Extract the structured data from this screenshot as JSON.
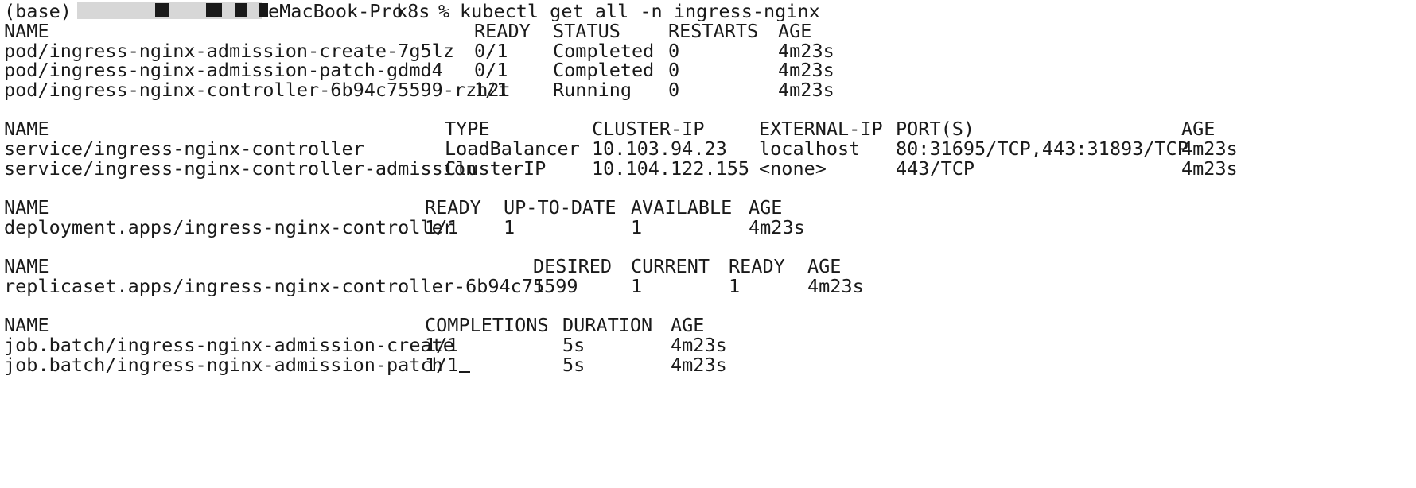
{
  "prompt": {
    "env": "(base)",
    "host_suffix": "eMacBook-Pro",
    "cwd": "k8s",
    "symbol": "%",
    "command": "kubectl get all -n ingress-nginx"
  },
  "pods": {
    "headers": [
      "NAME",
      "READY",
      "STATUS",
      "RESTARTS",
      "AGE"
    ],
    "rows": [
      [
        "pod/ingress-nginx-admission-create-7g5lz",
        "0/1",
        "Completed",
        "0",
        "4m23s"
      ],
      [
        "pod/ingress-nginx-admission-patch-gdmd4",
        "0/1",
        "Completed",
        "0",
        "4m23s"
      ],
      [
        "pod/ingress-nginx-controller-6b94c75599-rzh2t",
        "1/1",
        "Running",
        "0",
        "4m23s"
      ]
    ]
  },
  "services": {
    "headers": [
      "NAME",
      "TYPE",
      "CLUSTER-IP",
      "EXTERNAL-IP",
      "PORT(S)",
      "AGE"
    ],
    "rows": [
      [
        "service/ingress-nginx-controller",
        "LoadBalancer",
        "10.103.94.23",
        "localhost",
        "80:31695/TCP,443:31893/TCP",
        "4m23s"
      ],
      [
        "service/ingress-nginx-controller-admission",
        "ClusterIP",
        "10.104.122.155",
        "<none>",
        "443/TCP",
        "4m23s"
      ]
    ]
  },
  "deployments": {
    "headers": [
      "NAME",
      "READY",
      "UP-TO-DATE",
      "AVAILABLE",
      "AGE"
    ],
    "rows": [
      [
        "deployment.apps/ingress-nginx-controller",
        "1/1",
        "1",
        "1",
        "4m23s"
      ]
    ]
  },
  "replicasets": {
    "headers": [
      "NAME",
      "DESIRED",
      "CURRENT",
      "READY",
      "AGE"
    ],
    "rows": [
      [
        "replicaset.apps/ingress-nginx-controller-6b94c75599",
        "1",
        "1",
        "1",
        "4m23s"
      ]
    ]
  },
  "jobs": {
    "headers": [
      "NAME",
      "COMPLETIONS",
      "DURATION",
      "AGE"
    ],
    "rows": [
      [
        "job.batch/ingress-nginx-admission-create",
        "1/1",
        "5s",
        "4m23s"
      ],
      [
        "job.batch/ingress-nginx-admission-patch",
        "1/1",
        "5s",
        "4m23s"
      ]
    ]
  }
}
